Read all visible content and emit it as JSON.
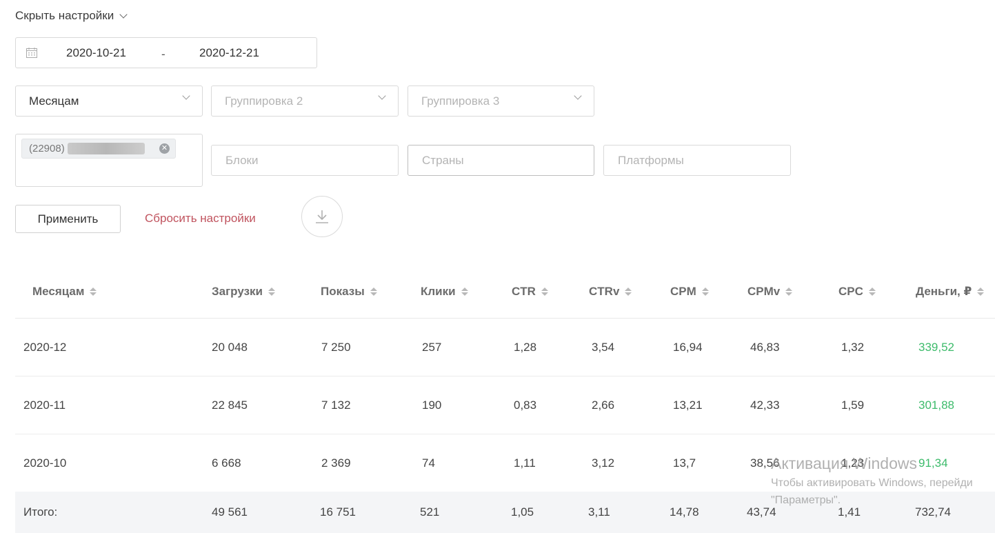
{
  "toggle_label": "Скрыть настройки",
  "date_range": {
    "from": "2020-10-21",
    "separator": "-",
    "to": "2020-12-21"
  },
  "grouping": {
    "group1_value": "Месяцам",
    "group2_placeholder": "Группировка 2",
    "group3_placeholder": "Группировка 3"
  },
  "filters": {
    "tag_prefix": "(22908)",
    "blocks_placeholder": "Блоки",
    "countries_placeholder": "Страны",
    "platforms_placeholder": "Платформы"
  },
  "actions": {
    "apply": "Применить",
    "reset": "Сбросить настройки"
  },
  "table": {
    "columns": [
      "Месяцам",
      "Загрузки",
      "Показы",
      "Клики",
      "CTR",
      "CTRv",
      "CPM",
      "CPMv",
      "CPC",
      "Деньги, ₽"
    ],
    "rows": [
      [
        "2020-12",
        "20 048",
        "7 250",
        "257",
        "1,28",
        "3,54",
        "16,94",
        "46,83",
        "1,32",
        "339,52"
      ],
      [
        "2020-11",
        "22 845",
        "7 132",
        "190",
        "0,83",
        "2,66",
        "13,21",
        "42,33",
        "1,59",
        "301,88"
      ],
      [
        "2020-10",
        "6 668",
        "2 369",
        "74",
        "1,11",
        "3,12",
        "13,7",
        "38,56",
        "1,23",
        "91,34"
      ]
    ],
    "total": [
      "Итого:",
      "49 561",
      "16 751",
      "521",
      "1,05",
      "3,11",
      "14,78",
      "43,74",
      "1,41",
      "732,74"
    ]
  },
  "watermark": {
    "title": "Активация Windows",
    "line1": "Чтобы активировать Windows, перейди",
    "line2": "\"Параметры\"."
  },
  "colors": {
    "money": "#3dbb6b",
    "reset_link": "#c0535e"
  }
}
